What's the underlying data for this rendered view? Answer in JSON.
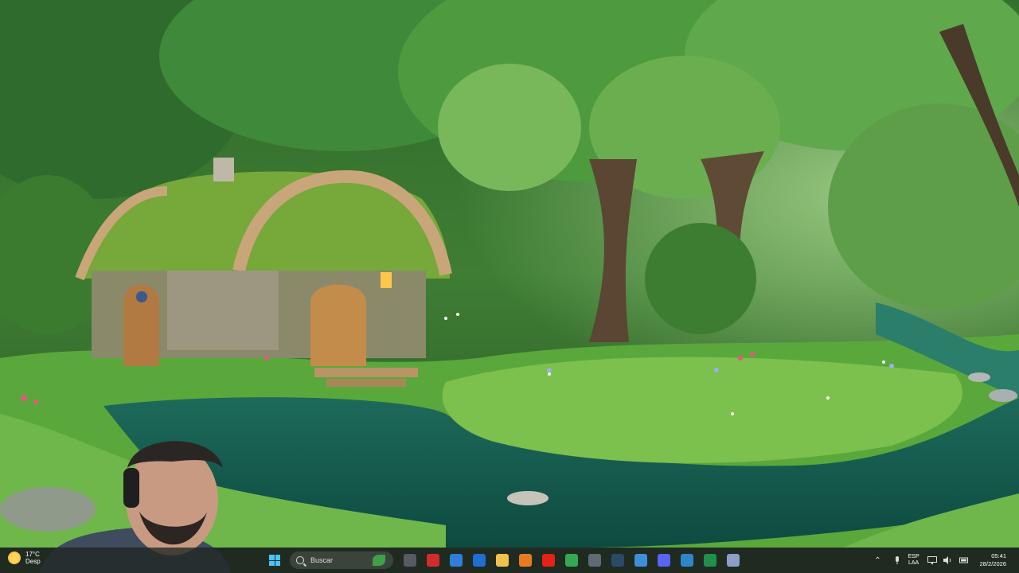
{
  "taskbar": {
    "weather": {
      "temperature": "17°C",
      "label_partial": "Desp"
    },
    "search": {
      "label": "Buscar"
    },
    "pinned_apps": [
      {
        "name": "file-explorer-icon",
        "color": "#555b63"
      },
      {
        "name": "app-red-icon",
        "color": "#d12c2c"
      },
      {
        "name": "microsoft-store-icon",
        "color": "#2f7fd8"
      },
      {
        "name": "outlook-icon",
        "color": "#1e6fd0"
      },
      {
        "name": "folder-icon",
        "color": "#f1c24b"
      },
      {
        "name": "app-orange-icon",
        "color": "#e67c22"
      },
      {
        "name": "youtube-icon",
        "color": "#e62117"
      },
      {
        "name": "chrome-icon",
        "color": "#34a853"
      },
      {
        "name": "gamepad-icon",
        "color": "#5c6b74"
      },
      {
        "name": "steam-icon",
        "color": "#2a4a6a"
      },
      {
        "name": "notepad-icon",
        "color": "#3f8fd8"
      },
      {
        "name": "discord-icon",
        "color": "#5865f2"
      },
      {
        "name": "photos-icon",
        "color": "#2d86c9"
      },
      {
        "name": "excel-icon",
        "color": "#1f8f4a"
      },
      {
        "name": "git-icon",
        "color": "#8aa0c8"
      }
    ],
    "tray": {
      "lang_top": "ESP",
      "lang_bottom": "LAA",
      "time": "05:41",
      "date": "28/2/2026"
    }
  }
}
